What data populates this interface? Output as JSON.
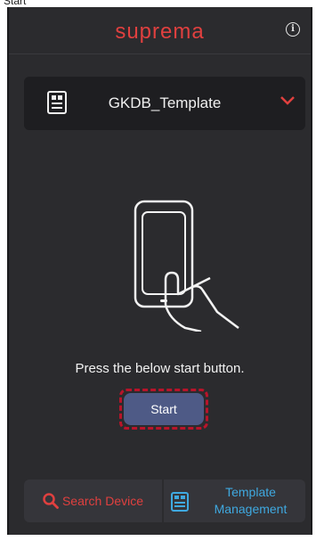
{
  "top_caption": "Start",
  "header": {
    "logo_text": "suprema",
    "info_icon": "info-icon"
  },
  "template_select": {
    "icon": "document-icon",
    "selected_value": "GKDB_Template",
    "chevron": "chevron-down-icon"
  },
  "main": {
    "illustration": "hand-holding-phone-illustration",
    "instruction": "Press the below start button.",
    "start_label": "Start"
  },
  "bottom_bar": {
    "search_label": "Search Device",
    "search_icon": "search-icon",
    "template_label_line1": "Template",
    "template_label_line2": "Management",
    "template_icon": "template-icon"
  },
  "colors": {
    "background": "#2b2b2e",
    "brand_red": "#e0403f",
    "start_button": "#4e5a86",
    "highlight_dash": "#b8142a",
    "link_blue": "#3fa9e0"
  }
}
